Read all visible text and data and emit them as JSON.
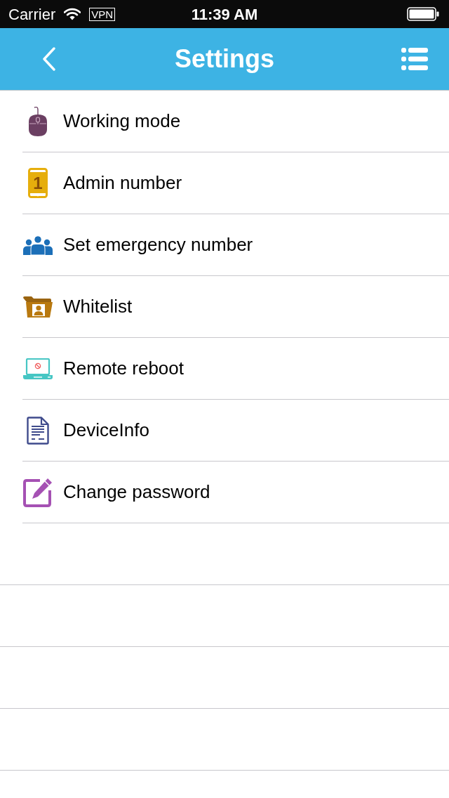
{
  "status_bar": {
    "carrier": "Carrier",
    "vpn": "VPN",
    "time": "11:39 AM"
  },
  "nav_bar": {
    "title": "Settings"
  },
  "settings": [
    {
      "label": "Working mode"
    },
    {
      "label": "Admin number",
      "icon_digit": "1"
    },
    {
      "label": "Set emergency number"
    },
    {
      "label": "Whitelist"
    },
    {
      "label": "Remote reboot"
    },
    {
      "label": "DeviceInfo"
    },
    {
      "label": "Change password"
    }
  ]
}
